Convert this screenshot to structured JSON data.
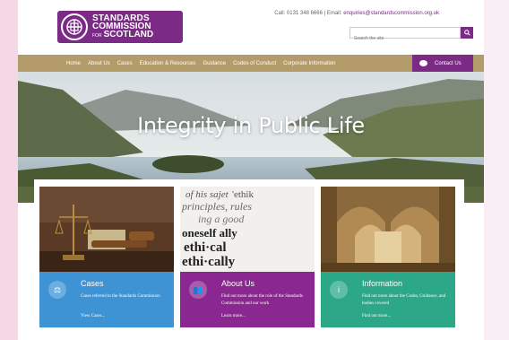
{
  "header": {
    "logo": {
      "line1": "STANDARDS",
      "line2": "COMMISSION",
      "line3_prefix": "FOR",
      "line3": "SCOTLAND"
    },
    "contact": {
      "call_label": "Call:",
      "phone": "0131 348 6666",
      "email_label": "Email:",
      "email": "enquiries@standardscommission.org.uk"
    },
    "search": {
      "placeholder": "Search the site",
      "button_icon": "search-icon"
    }
  },
  "nav": {
    "items": [
      "Home",
      "About Us",
      "Cases",
      "Education & Resources",
      "Guidance",
      "Codes of Conduct",
      "Corporate Information"
    ],
    "contact_button": "Contact Us",
    "contact_icon": "speech-bubble-icon"
  },
  "hero": {
    "title": "Integrity in Public Life"
  },
  "cards": [
    {
      "title": "Cases",
      "text": "Cases referred to the Standards Commission",
      "link": "View Cases...",
      "icon": "scales-icon",
      "color": "#3d93d4"
    },
    {
      "title": "About Us",
      "text": "Find out more about the role of the Standards Commission and our work",
      "link": "Learn more...",
      "icon": "people-icon",
      "color": "#8a2790"
    },
    {
      "title": "Information",
      "text": "Find out more about the Codes, Guidance, and bodies covered",
      "link": "Find out more...",
      "icon": "info-icon",
      "color": "#2ca888"
    }
  ],
  "colors": {
    "brand_purple": "#7b2a86",
    "nav_gold": "#b49c6a"
  }
}
